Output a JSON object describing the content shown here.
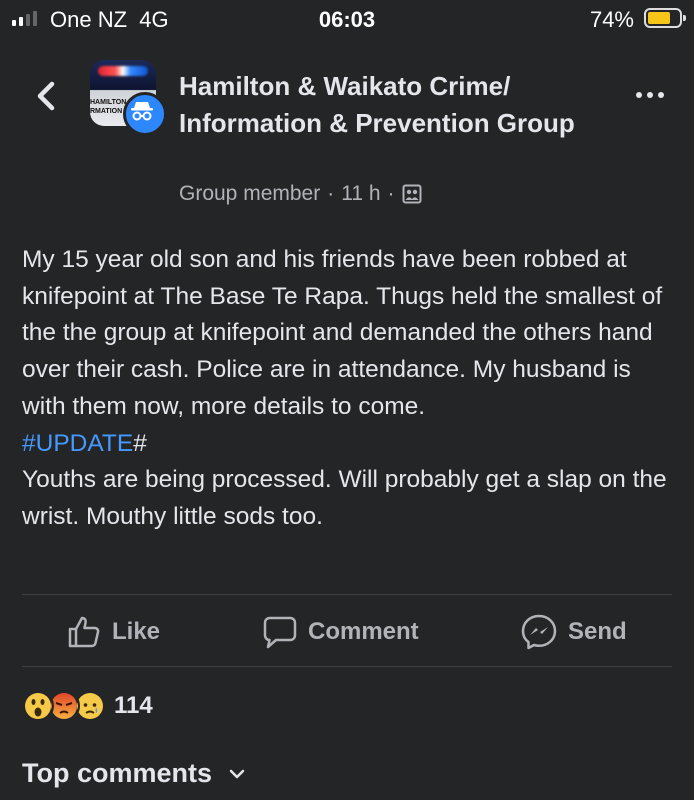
{
  "status_bar": {
    "carrier": "One NZ",
    "network": "4G",
    "time": "06:03",
    "battery_percent": "74%",
    "battery_level": 0.74,
    "battery_color": "#f5c518",
    "signal_bars": 2
  },
  "header": {
    "back_icon": "chevron-left-icon",
    "group_name": "Hamilton & Waikato Crime/ Information & Prevention Group",
    "avatar_text": "HAMILTON\nRMATION",
    "badge_icon": "anonymous-member-icon",
    "member_role": "Group member",
    "separator": "·",
    "time_ago": "11 h",
    "privacy_icon": "group-audience-icon",
    "more_icon": "more-options-icon"
  },
  "post": {
    "body": "My 15 year old son and his friends have been robbed at knifepoint at The Base Te Rapa. Thugs held the smallest of the the group at knifepoint and demanded the others hand over their cash. Police are in attendance. My husband is with them now, more details to come.",
    "hashtag": "#UPDATE",
    "hashtag_suffix": "#",
    "update_text": "Youths are being processed. Will probably get a slap on the wrist. Mouthy little sods too."
  },
  "actions": {
    "like": "Like",
    "comment": "Comment",
    "send": "Send"
  },
  "reactions": {
    "types": [
      "wow",
      "angry",
      "sad"
    ],
    "count": "114"
  },
  "comments": {
    "label": "Top comments"
  },
  "colors": {
    "background": "#242526",
    "hashtag": "#4599ff",
    "badge": "#2d88ff"
  }
}
